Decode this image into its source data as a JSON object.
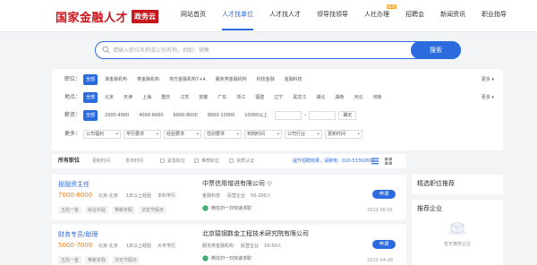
{
  "header": {
    "logo_text": "国家金融人才",
    "logo_badge": "政务云",
    "nav": [
      {
        "label": "网站首页",
        "active": false
      },
      {
        "label": "人才找单位",
        "active": true
      },
      {
        "label": "人才找人才",
        "active": false
      },
      {
        "label": "领导找领导",
        "active": false
      },
      {
        "label": "人社办理",
        "active": false,
        "badge": "NEW"
      },
      {
        "label": "招聘会",
        "active": false
      },
      {
        "label": "新闻资讯",
        "active": false
      },
      {
        "label": "职业指导",
        "active": false
      }
    ]
  },
  "search": {
    "placeholder": "请输入职位名称或公司名称，例如：销售",
    "button": "搜索"
  },
  "filters": {
    "industry": {
      "label": "职位：",
      "options": [
        "全部",
        "准金融机构",
        "类金融机构",
        "地方金融机构7+4",
        "服务类金融机构",
        "科技金融",
        "金融科技"
      ],
      "more": "更多"
    },
    "location": {
      "label": "地点：",
      "options": [
        "全部",
        "北京",
        "天津",
        "上海",
        "重庆",
        "江苏",
        "安徽",
        "广东",
        "浙江",
        "福建",
        "辽宁",
        "黑龙江",
        "湖北",
        "湖南",
        "河北",
        "河南"
      ],
      "more": "更多"
    },
    "salary": {
      "label": "薪资：",
      "options": [
        "全部",
        "2000-4000",
        "4000-6000",
        "6000-8000",
        "8000-10000",
        "10000以上"
      ],
      "dash": "-",
      "confirm": "确定"
    },
    "more_row": {
      "label": "更多：",
      "dropdowns": [
        "公司福利",
        "学历要求",
        "经验要求",
        "性别要求",
        "到岗时间",
        "公司行业",
        "更新时间"
      ]
    }
  },
  "toolbar": {
    "all_jobs": "所有职位",
    "sort_options": [
      "更新时间",
      "发布时间"
    ],
    "checkboxes": [
      "紧急职位",
      "推荐职位",
      "资质认证"
    ],
    "tip": "提升招聘效果，请致电：",
    "phone": "010-53392691"
  },
  "jobs": [
    {
      "title": "投融资主任",
      "salary": "7000-8000",
      "location": "北京-北京",
      "experience": "1年以上经验",
      "education": "本科学历",
      "tags": [
        "五险一金",
        "综合补贴",
        "带薪年假",
        "法定节假日"
      ],
      "company": "中票信用增进有限公司",
      "company_industry": "金融科技",
      "company_type": "民营企业",
      "company_size": "50-200人",
      "ad_text": "微信扫一扫快速求职",
      "apply": "申请",
      "date": "2022-06-01"
    },
    {
      "title": "财务专员/助理",
      "salary": "5000-7000",
      "location": "北京-北京",
      "experience": "1年以上经验",
      "education": "大专学历",
      "tags": [
        "五险一金",
        "带薪年假",
        "法定节假日"
      ],
      "company": "北京猿钢数金工程技术研究院有限公司",
      "company_industry": "服务类金融机构",
      "company_type": "民营企业",
      "company_size": "10-50人",
      "ad_text": "微信扫一扫快速求职",
      "apply": "申请",
      "date": "2022-04-28"
    }
  ],
  "sidebar": {
    "recommend_title": "精选职位推荐",
    "company_title": "推荐企业",
    "company_empty": "暂无推荐企业"
  },
  "colors": {
    "brand_red": "#c8161d",
    "accent_blue": "#2b6bde",
    "salary_orange": "#f07b1b"
  }
}
